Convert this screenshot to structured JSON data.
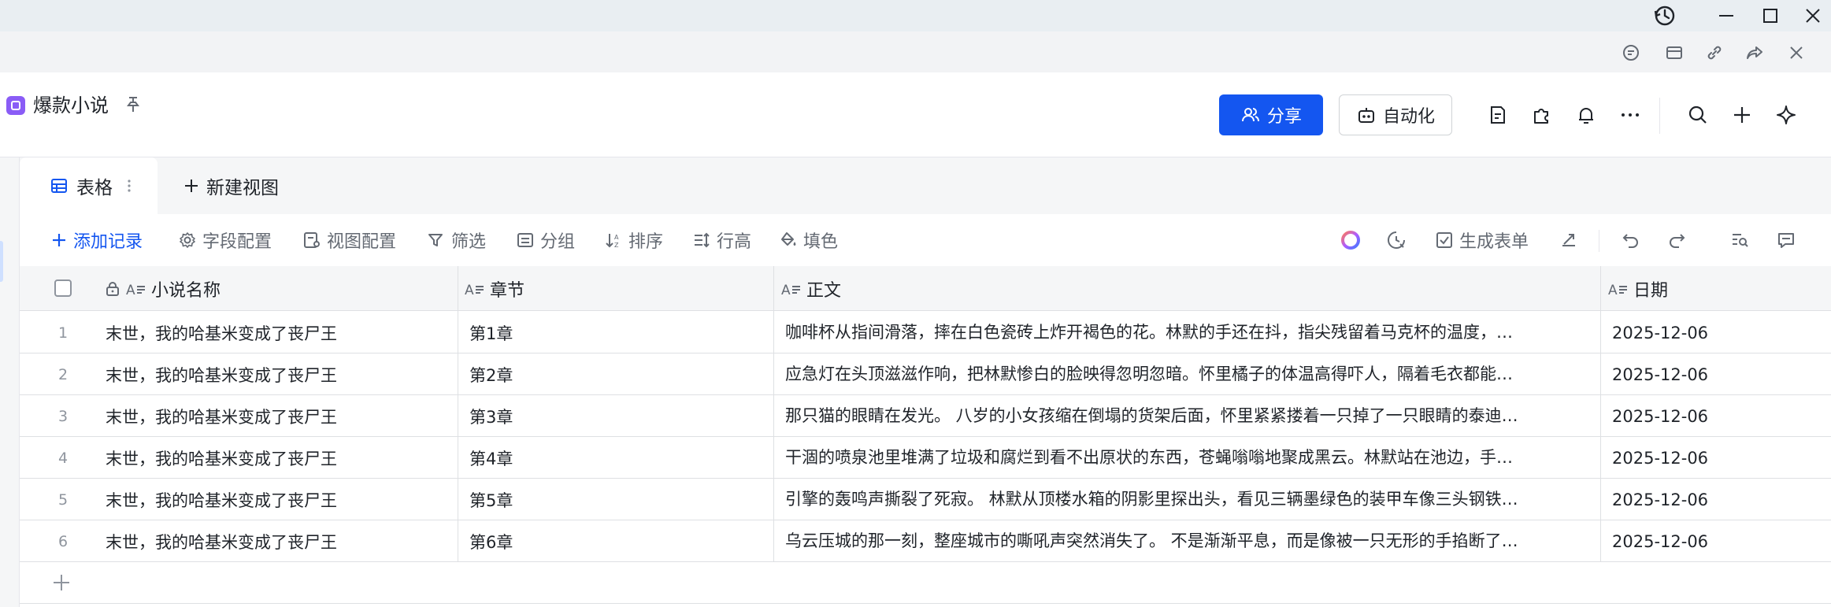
{
  "window": {
    "history_icon": "history-icon",
    "minimize_icon": "minimize-icon",
    "maximize_icon": "maximize-icon",
    "close_icon": "close-icon"
  },
  "toolbar1": {
    "icons": [
      "comment-icon",
      "card-icon",
      "link-icon",
      "forward-icon",
      "close-icon"
    ]
  },
  "header": {
    "doc_title": "爆款小说",
    "share_label": "分享",
    "automation_label": "自动化",
    "accent_color": "#1456f0"
  },
  "tabs": {
    "active_label": "表格",
    "new_view_label": "新建视图"
  },
  "viewbar": {
    "add_record": "添加记录",
    "field_config": "字段配置",
    "view_config": "视图配置",
    "filter": "筛选",
    "group": "分组",
    "sort": "排序",
    "row_height": "行高",
    "fill_color": "填色",
    "generate_form": "生成表单"
  },
  "table": {
    "columns": [
      "小说名称",
      "章节",
      "正文",
      "日期"
    ],
    "rows": [
      {
        "n": "1",
        "name": "末世，我的哈基米变成了丧尸王",
        "chapter": "第1章",
        "text": "咖啡杯从指间滑落，摔在白色瓷砖上炸开褐色的花。林默的手还在抖，指尖残留着马克杯的温度，…",
        "date": "2025-12-06"
      },
      {
        "n": "2",
        "name": "末世，我的哈基米变成了丧尸王",
        "chapter": "第2章",
        "text": "应急灯在头顶滋滋作响，把林默惨白的脸映得忽明忽暗。怀里橘子的体温高得吓人，隔着毛衣都能…",
        "date": "2025-12-06"
      },
      {
        "n": "3",
        "name": "末世，我的哈基米变成了丧尸王",
        "chapter": "第3章",
        "text": "那只猫的眼睛在发光。 八岁的小女孩缩在倒塌的货架后面，怀里紧紧搂着一只掉了一只眼睛的泰迪…",
        "date": "2025-12-06"
      },
      {
        "n": "4",
        "name": "末世，我的哈基米变成了丧尸王",
        "chapter": "第4章",
        "text": "干涸的喷泉池里堆满了垃圾和腐烂到看不出原状的东西，苍蝇嗡嗡地聚成黑云。林默站在池边，手…",
        "date": "2025-12-06"
      },
      {
        "n": "5",
        "name": "末世，我的哈基米变成了丧尸王",
        "chapter": "第5章",
        "text": "引擎的轰鸣声撕裂了死寂。 林默从顶楼水箱的阴影里探出头，看见三辆墨绿色的装甲车像三头钢铁…",
        "date": "2025-12-06"
      },
      {
        "n": "6",
        "name": "末世，我的哈基米变成了丧尸王",
        "chapter": "第6章",
        "text": "乌云压城的那一刻，整座城市的嘶吼声突然消失了。 不是渐渐平息，而是像被一只无形的手掐断了…",
        "date": "2025-12-06"
      }
    ]
  }
}
